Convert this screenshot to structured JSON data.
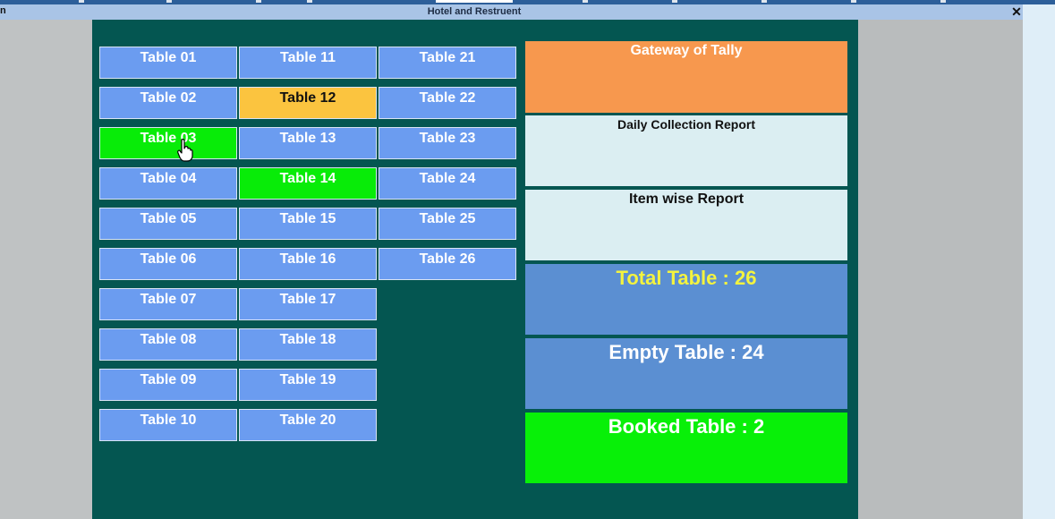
{
  "window": {
    "title": "Hotel and Restruent",
    "left_fragment": "n",
    "close_icon": "close-icon"
  },
  "tables": [
    {
      "label": "Table 01",
      "status": "empty"
    },
    {
      "label": "Table 02",
      "status": "empty"
    },
    {
      "label": "Table 03",
      "status": "booked"
    },
    {
      "label": "Table 04",
      "status": "empty"
    },
    {
      "label": "Table 05",
      "status": "empty"
    },
    {
      "label": "Table 06",
      "status": "empty"
    },
    {
      "label": "Table 07",
      "status": "empty"
    },
    {
      "label": "Table 08",
      "status": "empty"
    },
    {
      "label": "Table 09",
      "status": "empty"
    },
    {
      "label": "Table 10",
      "status": "empty"
    },
    {
      "label": "Table 11",
      "status": "empty"
    },
    {
      "label": "Table 12",
      "status": "selected"
    },
    {
      "label": "Table 13",
      "status": "empty"
    },
    {
      "label": "Table 14",
      "status": "booked"
    },
    {
      "label": "Table 15",
      "status": "empty"
    },
    {
      "label": "Table 16",
      "status": "empty"
    },
    {
      "label": "Table 17",
      "status": "empty"
    },
    {
      "label": "Table 18",
      "status": "empty"
    },
    {
      "label": "Table 19",
      "status": "empty"
    },
    {
      "label": "Table 20",
      "status": "empty"
    },
    {
      "label": "Table 21",
      "status": "empty"
    },
    {
      "label": "Table 22",
      "status": "empty"
    },
    {
      "label": "Table 23",
      "status": "empty"
    },
    {
      "label": "Table 24",
      "status": "empty"
    },
    {
      "label": "Table 25",
      "status": "empty"
    },
    {
      "label": "Table 26",
      "status": "empty"
    }
  ],
  "panels": {
    "gateway": "Gateway of Tally",
    "daily_collection": "Daily Collection Report",
    "item_wise": "Item wise Report",
    "total": "Total Table : 26",
    "empty": "Empty Table : 24",
    "booked": "Booked Table : 2"
  },
  "colors": {
    "background": "#045651",
    "table_empty": "#6b9cf0",
    "table_selected": "#fbc43f",
    "table_booked": "#08ec08",
    "gateway": "#f7984e",
    "report_panel": "#dbeef2",
    "count_panel": "#5b8fd2",
    "total_text": "#f3f33f",
    "booked_panel": "#08f008"
  }
}
